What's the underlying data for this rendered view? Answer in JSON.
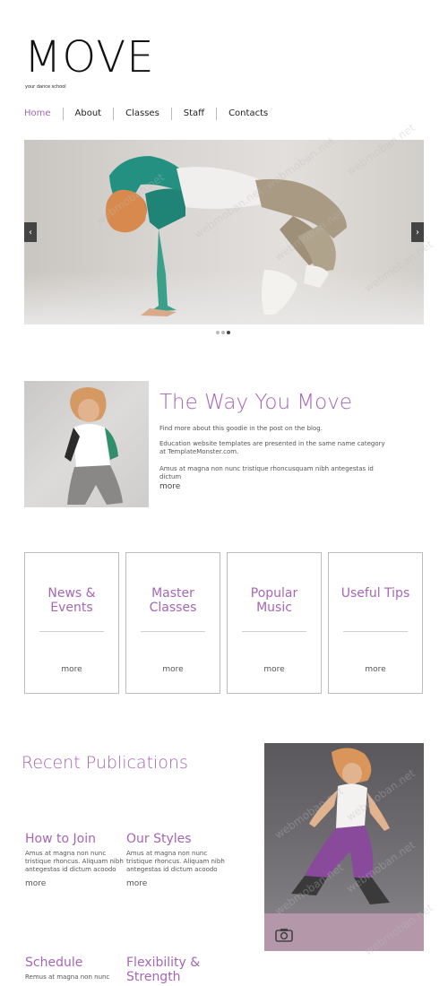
{
  "header": {
    "logo": "MOVE",
    "tagline": "your dance school"
  },
  "nav": {
    "items": [
      {
        "label": "Home",
        "active": true
      },
      {
        "label": "About"
      },
      {
        "label": "Classes"
      },
      {
        "label": "Staff"
      },
      {
        "label": "Contacts"
      }
    ]
  },
  "slider": {
    "prev_icon": "chevron-left-icon",
    "next_icon": "chevron-right-icon",
    "dots": 3,
    "active_dot": 3
  },
  "about": {
    "title": "The Way You Move",
    "p1": "Find more about this goodie in the post on the blog.",
    "p2": "Education website templates are presented in the same name category at TemplateMonster.com.",
    "p3": "Amus at magna non nunc tristique rhoncusquam nibh antegestas id dictum",
    "more": "more"
  },
  "cards": [
    {
      "title": "News & Events",
      "more": "more"
    },
    {
      "title": "Master Classes",
      "more": "more"
    },
    {
      "title": "Popular Music",
      "more": "more"
    },
    {
      "title": "Useful Tips",
      "more": "more"
    }
  ],
  "publications": {
    "heading": "Recent Publications",
    "items": [
      {
        "title": "How to Join",
        "text": "Amus at magna non nunc tristique rhoncus. Aliquam nibh antegestas id dictum acoodo",
        "more": "more"
      },
      {
        "title": "Our Styles",
        "text": "Amus at magna non nunc tristique rhoncus. Aliquam nibh antegestas id dictum acoodo",
        "more": "more"
      },
      {
        "title": "Schedule",
        "text": "Remus at magna non nunc",
        "more": ""
      },
      {
        "title": "Flexibility & Strength",
        "text": "",
        "more": ""
      }
    ]
  },
  "photo": {
    "camera_icon": "camera-icon"
  },
  "watermark": "webmoban.net",
  "colors": {
    "accent": "#a566b4",
    "photo_bar": "#b498aa",
    "arrow_bg": "#444444"
  }
}
